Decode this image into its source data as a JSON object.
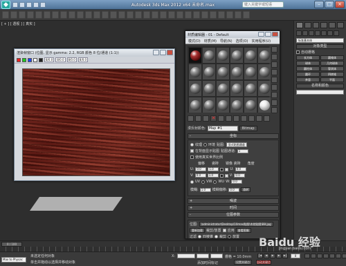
{
  "title_bar": {
    "title": "Autodesk 3ds Max  2012 x64    未命名.max",
    "search_placeholder": "键入关键字或短语",
    "minimize": "–",
    "maximize": "□",
    "close": "×"
  },
  "viewport": {
    "label": "[ + ] [ 透视 ] [ 真实 ]"
  },
  "texture_window": {
    "title": "渲染帧窗口 (位图, 显示 gamma: 2.2, RGB 颜色 8 位/通道 (1:1))",
    "zoom_field": "8/0.0",
    "channel_fields": [
      "8/0.0",
      "8/0.0",
      "8/0.0"
    ]
  },
  "material_editor": {
    "title": "材质编辑器 - 01 - Default",
    "menu": [
      "模式(D)",
      "材质(M)",
      "导航(N)",
      "选项(O)",
      "实用程序(U)"
    ],
    "map_label": "漫反射颜色:",
    "material_name": "Map #1",
    "material_type": "Bitmap",
    "coords_rollout": "坐标",
    "coords": {
      "texture_radio": "纹理",
      "environ_radio": "环境",
      "mapping_label": "贴图:",
      "mapping_value": "显式贴图通道",
      "channel_label": "贴图通道:",
      "channel_value": "1",
      "show_on_back": "在背面显示贴图",
      "use_real_world": "使用真实世界比例",
      "offset_header": "偏移",
      "tiling_header": "瓷砖",
      "mirror_tile_header": "镜像 瓷砖",
      "angle_header": "角度",
      "u_label": "U:",
      "v_label": "V:",
      "w_label": "W:",
      "u_offset": "0.0",
      "v_offset": "0.0",
      "u_tiling": "1.0",
      "v_tiling": "1.0",
      "u_angle": "0.0",
      "v_angle": "0.0",
      "w_angle": "0.0",
      "uv_radio": "UV",
      "vw_radio": "VW",
      "wu_radio": "WU",
      "blur_label": "模糊:",
      "blur_value": "1.0",
      "blur_offset_label": "模糊偏移:",
      "blur_offset_value": "0.0",
      "rotate_button": "旋转"
    },
    "noise_rollout": "噪波",
    "time_rollout": "时间",
    "bitmap_rollout": "位图参数",
    "bitmap": {
      "path_label": "位图:",
      "path_value": "\\administrator\\Desktop\\10max贴图\\木纹贴图\\B8.jpg",
      "reload_label": "重新加载",
      "crop_header": "裁剪/放置",
      "apply_check": "应用",
      "view_image_button": "查看图像",
      "filter_header": "过滤",
      "pyramidal": "四棱锥",
      "summed_area": "总面积",
      "none": "无",
      "crop_radio": "裁剪",
      "place_radio": "放置",
      "u_label": "U:",
      "u_value": "0.0",
      "w_label": "W:",
      "w_value": "1.0"
    }
  },
  "command_panel": {
    "category": "标准基本体",
    "object_type_rollout": "对象类型",
    "autogrid": "自动栅格",
    "buttons": [
      "长方体",
      "圆锥体",
      "球体",
      "几何球体",
      "圆柱体",
      "管状体",
      "圆环",
      "四棱锥",
      "茶壶",
      "平面"
    ],
    "name_color_rollout": "名称和颜色"
  },
  "timeline": {
    "handle": "0 / 100"
  },
  "status_bar": {
    "maxscript_placeholder": "Max to Physac",
    "line1": "未选定任何对象",
    "line2": "单击并拖动以选择并移动对象",
    "x_label": "X:",
    "y_label": "Y:",
    "z_label": "Z:",
    "grid_label": "栅格 = 10.0mm",
    "add_time_tag": "添加时间标记",
    "auto_key": "自动关键点",
    "set_key": "设置关键点",
    "key_filter": "选定对象",
    "frame": "0"
  },
  "watermark": {
    "text": "Baidu 经验",
    "url": "jingyan.baidu.com"
  }
}
